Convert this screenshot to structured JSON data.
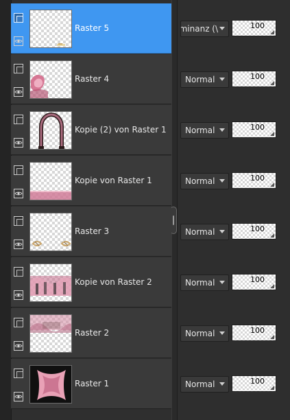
{
  "layers": [
    {
      "name": "Raster 5",
      "blend_mode": "uminanz (\\",
      "opacity": "100",
      "selected": true
    },
    {
      "name": "Raster 4",
      "blend_mode": "Normal",
      "opacity": "100",
      "selected": false
    },
    {
      "name": "Kopie (2) von Raster 1",
      "blend_mode": "Normal",
      "opacity": "100",
      "selected": false
    },
    {
      "name": "Kopie von Raster 1",
      "blend_mode": "Normal",
      "opacity": "100",
      "selected": false
    },
    {
      "name": "Raster 3",
      "blend_mode": "Normal",
      "opacity": "100",
      "selected": false
    },
    {
      "name": "Kopie von Raster 2",
      "blend_mode": "Normal",
      "opacity": "100",
      "selected": false
    },
    {
      "name": "Raster 2",
      "blend_mode": "Normal",
      "opacity": "100",
      "selected": false
    },
    {
      "name": "Raster 1",
      "blend_mode": "Normal",
      "opacity": "100",
      "selected": false
    }
  ],
  "colors": {
    "selected_row": "#3f97f1",
    "row_bg": "#3a3a3a",
    "panel_bg": "#2b2b2b"
  },
  "icons": {
    "layer_type": "raster-layer-icon",
    "visibility": "eye-icon",
    "splitter": "splitter-handle"
  }
}
